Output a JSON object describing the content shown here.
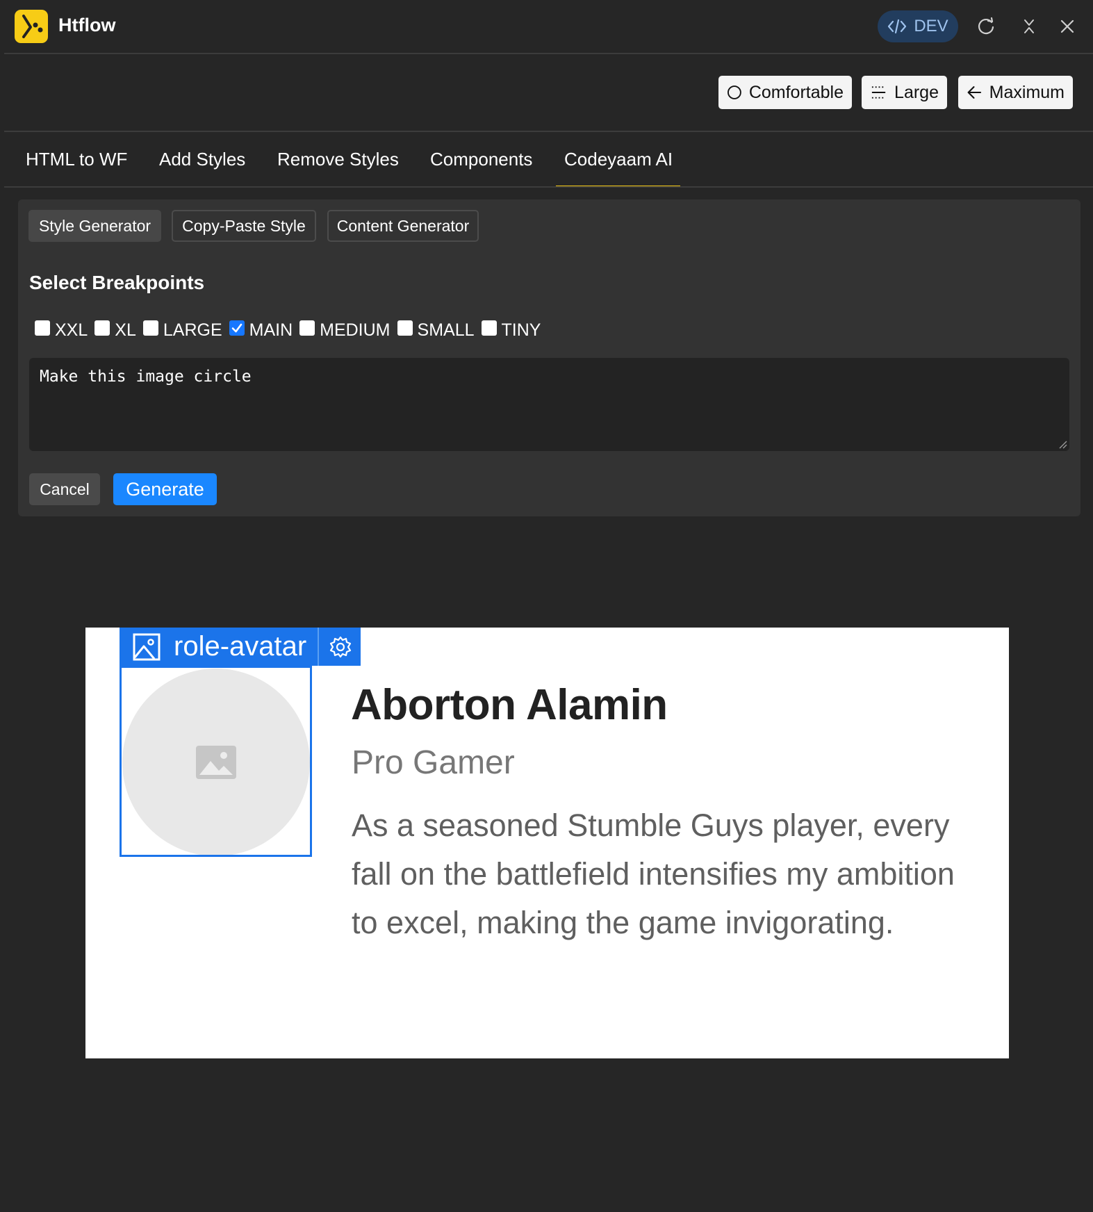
{
  "app": {
    "title": "Htflow",
    "env_badge": "DEV",
    "brand_color": "#f7cc16",
    "accent_color": "#1a87ff"
  },
  "size_controls": [
    {
      "label": "Comfortable",
      "icon": "circle-icon"
    },
    {
      "label": "Large",
      "icon": "lines-icon"
    },
    {
      "label": "Maximum",
      "icon": "arrow-left-icon"
    }
  ],
  "tabs": [
    {
      "label": "HTML to WF",
      "active": false
    },
    {
      "label": "Add Styles",
      "active": false
    },
    {
      "label": "Remove Styles",
      "active": false
    },
    {
      "label": "Components",
      "active": false
    },
    {
      "label": "Codeyaam AI",
      "active": true
    }
  ],
  "subtabs": [
    {
      "label": "Style Generator",
      "active": true
    },
    {
      "label": "Copy-Paste Style",
      "active": false
    },
    {
      "label": "Content Generator",
      "active": false
    }
  ],
  "breakpoints": {
    "title": "Select Breakpoints",
    "items": [
      {
        "label": "XXL",
        "checked": false
      },
      {
        "label": "XL",
        "checked": false
      },
      {
        "label": "LARGE",
        "checked": false
      },
      {
        "label": "MAIN",
        "checked": true
      },
      {
        "label": "MEDIUM",
        "checked": false
      },
      {
        "label": "SMALL",
        "checked": false
      },
      {
        "label": "TINY",
        "checked": false
      }
    ]
  },
  "prompt": {
    "value": "Make this image circle"
  },
  "actions": {
    "cancel_label": "Cancel",
    "generate_label": "Generate"
  },
  "preview": {
    "selected_tag": "role-avatar",
    "name": "Aborton Alamin",
    "role": "Pro Gamer",
    "bio": "As a seasoned Stumble Guys player, every fall on the battlefield intensifies my ambition to excel, making the game invigorating."
  }
}
